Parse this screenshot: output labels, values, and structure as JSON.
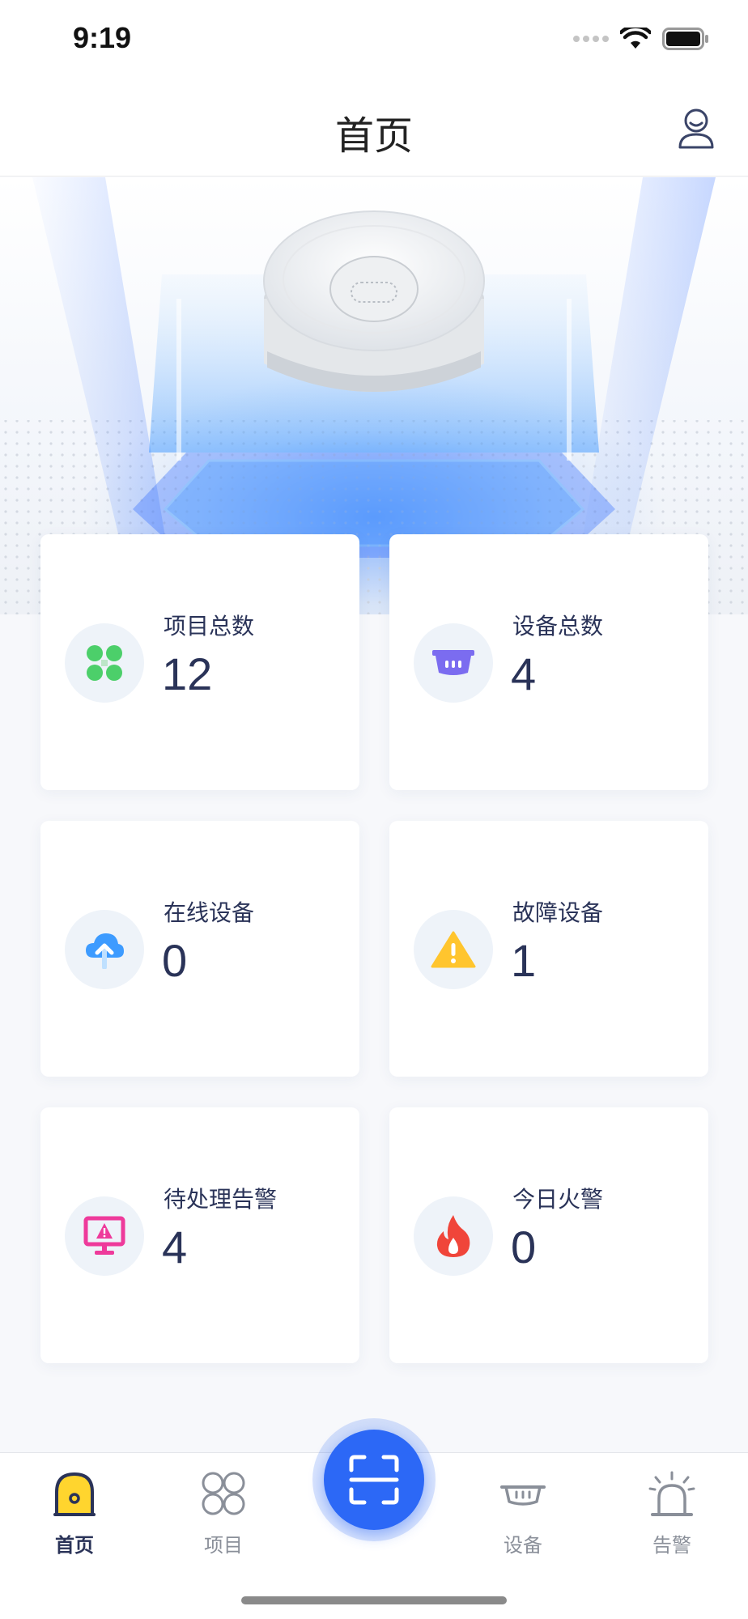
{
  "status_bar": {
    "time": "9:19"
  },
  "nav": {
    "title": "首页",
    "user_icon": "user-icon"
  },
  "stats": [
    {
      "label": "项目总数",
      "value": "12",
      "icon": "projects-grid-icon",
      "color": "#4ccf6a"
    },
    {
      "label": "设备总数",
      "value": "4",
      "icon": "smoke-detector-icon",
      "color": "#7b6cf0"
    },
    {
      "label": "在线设备",
      "value": "0",
      "icon": "cloud-upload-icon",
      "color": "#3d9bff"
    },
    {
      "label": "故障设备",
      "value": "1",
      "icon": "warning-triangle-icon",
      "color": "#ffc52e"
    },
    {
      "label": "待处理告警",
      "value": "4",
      "icon": "monitor-alert-icon",
      "color": "#ee3a9b"
    },
    {
      "label": "今日火警",
      "value": "0",
      "icon": "fire-icon",
      "color": "#f0453a"
    }
  ],
  "tab_bar": {
    "tabs": [
      {
        "label": "首页",
        "icon": "home-icon",
        "active": true
      },
      {
        "label": "项目",
        "icon": "projects-icon",
        "active": false
      },
      {
        "label": "设备",
        "icon": "device-icon",
        "active": false
      },
      {
        "label": "告警",
        "icon": "alarm-icon",
        "active": false
      }
    ],
    "center_button": {
      "icon": "scan-icon",
      "color": "#2c68f6"
    }
  },
  "colors": {
    "accent": "#2c68f6",
    "text_primary": "#2a3358",
    "tab_inactive": "#8a8f99"
  }
}
